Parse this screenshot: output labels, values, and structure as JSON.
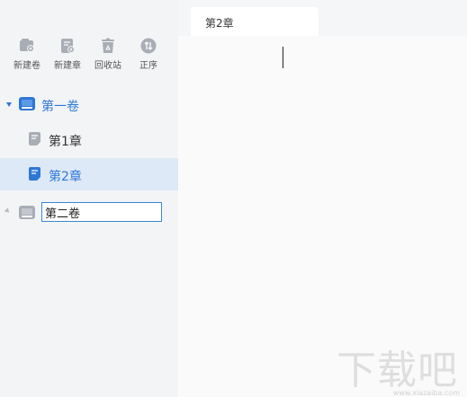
{
  "toolbar": {
    "new_volume": "新建卷",
    "new_chapter": "新建章",
    "recycle_bin": "回收站",
    "sort": "正序"
  },
  "tree": {
    "volume1": "第一卷",
    "chapter1": "第1章",
    "chapter2": "第2章",
    "volume2_edit_value": "第二卷"
  },
  "editor": {
    "tab_title": "第2章"
  },
  "watermark": {
    "text": "下载吧",
    "sub": "www.xiazaiba.com"
  },
  "colors": {
    "accent": "#2f77d6",
    "selected_bg": "#dde9f7",
    "icon_gray": "#a9adb5"
  }
}
